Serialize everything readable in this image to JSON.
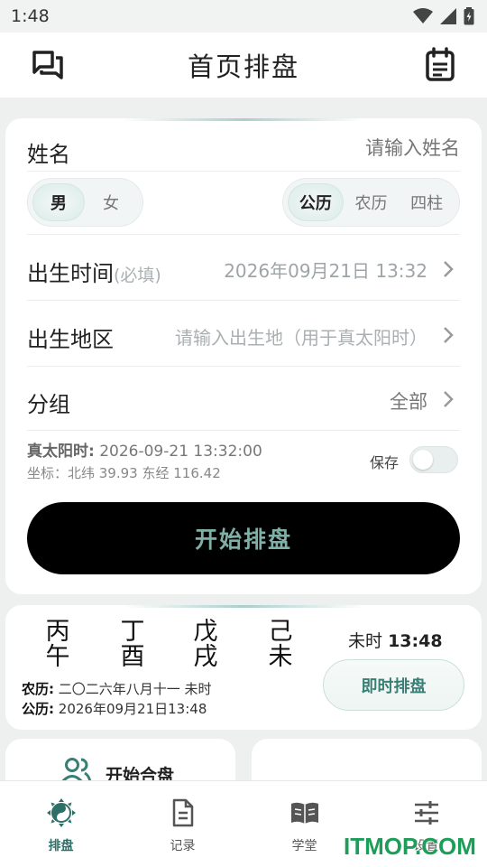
{
  "status_bar": {
    "time": "1:48"
  },
  "app_bar": {
    "title": "首页排盘",
    "left_icon": "chat-icon",
    "right_icon": "calendar-icon"
  },
  "form": {
    "name_label": "姓名",
    "name_placeholder": "请输入姓名",
    "gender": {
      "options": [
        "男",
        "女"
      ],
      "selected": "男"
    },
    "calendar_type": {
      "options": [
        "公历",
        "农历",
        "四柱"
      ],
      "selected": "公历"
    },
    "birth_time_label": "出生时间",
    "birth_time_required": "(必填)",
    "birth_time_value": "2026年09月21日 13:32",
    "birth_place_label": "出生地区",
    "birth_place_placeholder": "请输入出生地（用于真太阳时）",
    "group_label": "分组",
    "group_value": "全部",
    "solar_time_label": "真太阳时:",
    "solar_time_value": "2026-09-21 13:32:00",
    "coords": "坐标：北纬 39.93  东经 116.42",
    "save_label": "保存",
    "save_enabled": false,
    "start_button": "开始排盘"
  },
  "current": {
    "pillars": [
      {
        "top": "丙",
        "bottom": "午"
      },
      {
        "top": "丁",
        "bottom": "酉"
      },
      {
        "top": "戊",
        "bottom": "戌"
      },
      {
        "top": "己",
        "bottom": "未"
      }
    ],
    "hour_label": "未时",
    "hour_time": "13:48",
    "lunar_label": "农历:",
    "lunar_value": "二〇二六年八月十一 未时",
    "solar_label": "公历:",
    "solar_value": "2026年09月21日13:48",
    "now_button": "即时排盘"
  },
  "secondary": {
    "combine_label": "开始合盘"
  },
  "bottom_nav": [
    {
      "label": "排盘",
      "icon": "yin-yang-icon",
      "active": true
    },
    {
      "label": "记录",
      "icon": "document-icon",
      "active": false
    },
    {
      "label": "学堂",
      "icon": "book-icon",
      "active": false
    },
    {
      "label": "设置",
      "icon": "sliders-icon",
      "active": false
    }
  ],
  "watermark": "ITMOP.COM",
  "colors": {
    "accent": "#2e6f68",
    "button_text": "#7fb0a8",
    "background": "#eef0f0"
  }
}
